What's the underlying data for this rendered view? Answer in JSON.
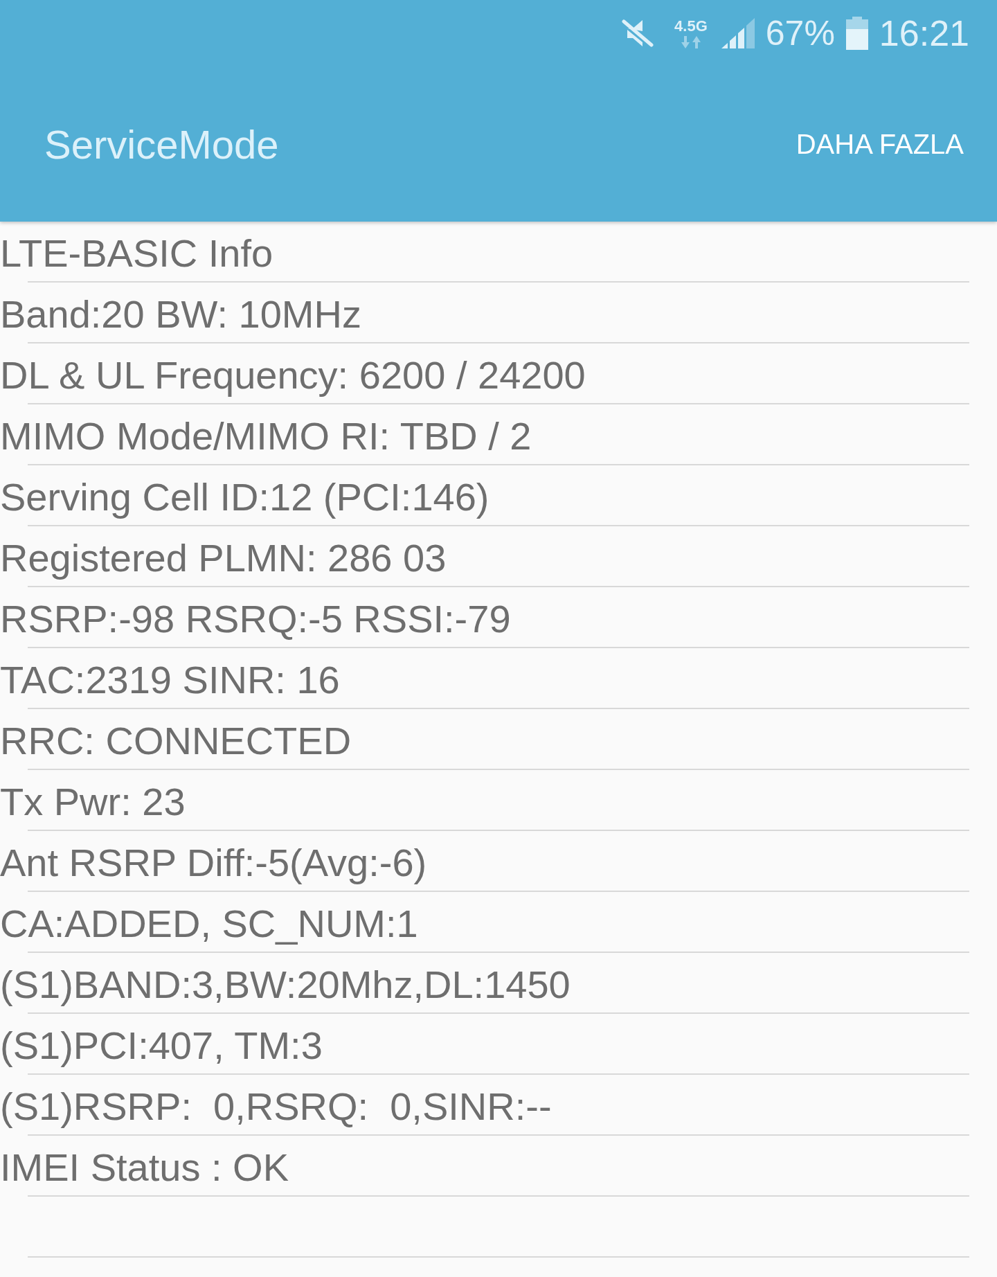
{
  "status_bar": {
    "network_type": "4.5G",
    "battery": "67%",
    "time": "16:21"
  },
  "app_bar": {
    "title": "ServiceMode",
    "menu_button": "DAHA FAZLA"
  },
  "info_lines": [
    "LTE-BASIC Info",
    "Band:20 BW: 10MHz",
    "DL & UL Frequency: 6200 / 24200",
    "MIMO Mode/MIMO RI: TBD / 2",
    "Serving Cell ID:12 (PCI:146)",
    "Registered PLMN: 286 03",
    "RSRP:-98 RSRQ:-5 RSSI:-79",
    "TAC:2319 SINR: 16",
    "RRC: CONNECTED",
    "Tx Pwr: 23",
    "Ant RSRP Diff:-5(Avg:-6)",
    "CA:ADDED, SC_NUM:1",
    "(S1)BAND:3,BW:20Mhz,DL:1450",
    "(S1)PCI:407, TM:3",
    "(S1)RSRP:  0,RSRQ:  0,SINR:--",
    "IMEI Status : OK"
  ]
}
